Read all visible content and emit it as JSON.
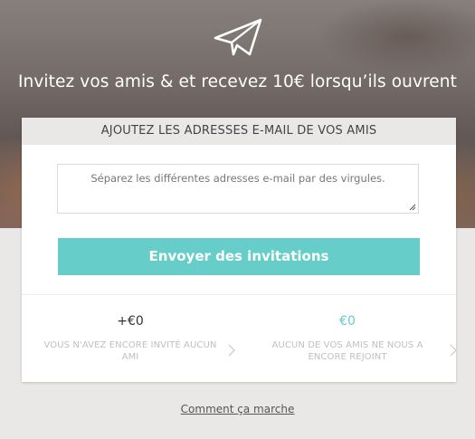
{
  "hero": {
    "icon": "paper-plane-icon",
    "headline": "Invitez vos amis & et recevez 10€ lorsqu’ils ouvrent"
  },
  "card": {
    "header": "AJOUTEZ LES ADRESSES E-MAIL DE VOS AMIS",
    "email_placeholder": "Séparez les différentes adresses e-mail par des virgules.",
    "send_label": "Envoyer des invitations"
  },
  "stats": {
    "invited_value": "+€0",
    "invited_text": "VOUS N'AVEZ ENCORE INVITÉ AUCUN AMI",
    "joined_value": "€0",
    "joined_text": "AUCUN DE VOS AMIS NE NOUS A ENCORE REJOINT"
  },
  "footer": {
    "how_label": "Comment ça marche"
  },
  "colors": {
    "accent": "#66cdc9",
    "page_background": "#e9e8e7"
  }
}
